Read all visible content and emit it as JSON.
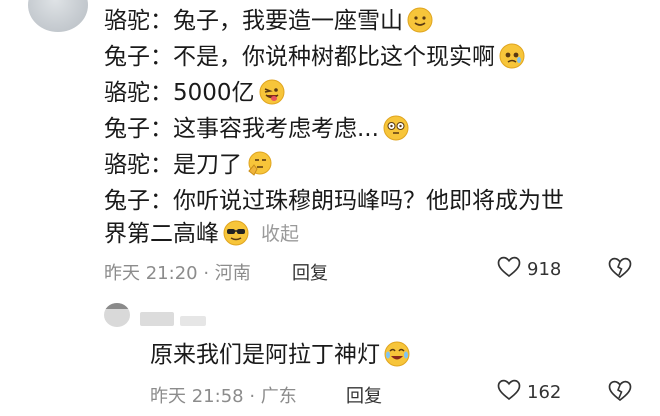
{
  "comment": {
    "lines": [
      {
        "text": "骆驼：兔子，我要造一座雪山",
        "emoji": "smiling-face-icon"
      },
      {
        "text": "兔子：不是，你说种树都比这个现实啊",
        "emoji": "pleading-face-icon"
      },
      {
        "text": "骆驼：5000亿",
        "emoji": "winking-tongue-face-icon"
      },
      {
        "text": "兔子：这事容我考虑考虑...",
        "emoji": "dizzy-eyes-face-icon"
      },
      {
        "text": "骆驼：是刀了",
        "emoji": "thinking-face-icon"
      },
      {
        "text": "兔子：你听说过珠穆朗玛峰吗？他即将成为世",
        "emoji": ""
      },
      {
        "text": "界第二高峰",
        "emoji": "sunglasses-face-icon"
      }
    ],
    "collapse_label": "收起",
    "time": "昨天 21:20 · 河南",
    "reply_label": "回复",
    "likes": "918"
  },
  "sub_comment": {
    "text": "原来我们是阿拉丁神灯",
    "emoji": "crying-laughing-face-icon",
    "time": "昨天 21:58 · 广东",
    "reply_label": "回复",
    "likes": "162"
  }
}
